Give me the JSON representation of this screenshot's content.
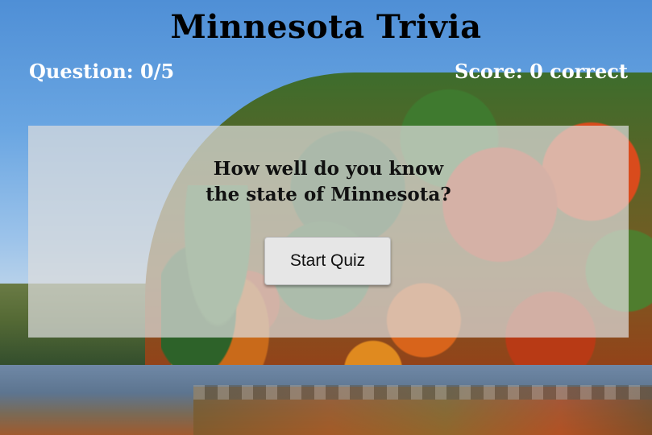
{
  "header": {
    "title": "Minnesota Trivia"
  },
  "stats": {
    "question_label": "Question: 0/5",
    "score_label": "Score: 0 correct"
  },
  "intro_card": {
    "prompt_line_1": "How well do you know",
    "prompt_line_2": "the state of Minnesota?",
    "start_button_label": "Start Quiz"
  },
  "colors": {
    "title_text": "#000000",
    "stat_text": "#ffffff",
    "panel_background": "#dcdcdc",
    "button_background": "#e6e6e6"
  },
  "background_image": "autumn-lake-forest-photo"
}
